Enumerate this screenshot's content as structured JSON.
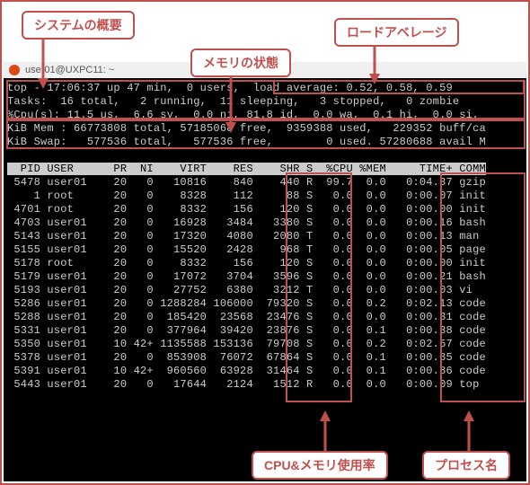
{
  "callouts": {
    "system_overview": "システムの概要",
    "memory_state": "メモリの状態",
    "load_average": "ロードアベレージ",
    "cpu_mem_usage": "CPU&メモリ使用率",
    "process_name": "プロセス名"
  },
  "window": {
    "title": "user01@UXPC11: ~"
  },
  "summary": {
    "line1": "top - 17:06:37 up 47 min,  0 users,  load average: 0.52, 0.58, 0.59",
    "line2": "Tasks:  16 total,   2 running,  11 sleeping,   3 stopped,   0 zombie",
    "line3": "%Cpu(s): 11.5 us,  6.6 sy,  0.0 ni, 81.8 id,  0.0 wa,  0.1 hi,  0.0 si,",
    "line4": "KiB Mem : 66773808 total, 57185068 free,  9359388 used,   229352 buff/ca",
    "line5": "KiB Swap:   577536 total,   577536 free,        0 used. 57280688 avail M"
  },
  "header": "  PID USER      PR  NI    VIRT    RES    SHR S  %CPU %MEM     TIME+ COMM",
  "rows": [
    " 5478 user01    20   0   10816    840    440 R  99.7  0.0   0:04.37 gzip",
    "    1 root      20   0    8328    112     88 S   0.0  0.0   0:00.07 init",
    " 4701 root      20   0    8332    156    120 S   0.0  0.0   0:00.00 init",
    " 4703 user01    20   0   16928   3484   3380 S   0.0  0.0   0:00.16 bash",
    " 5143 user01    20   0   17320   4080   2080 T   0.0  0.0   0:00.13 man",
    " 5155 user01    20   0   15520   2428    968 T   0.0  0.0   0:00.05 page",
    " 5178 root      20   0    8332    156    120 S   0.0  0.0   0:00.00 init",
    " 5179 user01    20   0   17072   3704   3596 S   0.0  0.0   0:00.21 bash",
    " 5193 user01    20   0   27752   6380   3212 T   0.0  0.0   0:00.03 vi  ",
    " 5286 user01    20   0 1288284 106000  79320 S   0.0  0.2   0:02.13 code",
    " 5288 user01    20   0  185420  23568  23476 S   0.0  0.0   0:00.31 code",
    " 5331 user01    20   0  377964  39420  23876 S   0.0  0.1   0:00.38 code",
    " 5350 user01    10 42+ 1135588 153136  79708 S   0.0  0.2   0:02.57 code",
    " 5378 user01    20   0  853908  76072  67864 S   0.0  0.1   0:00.85 code",
    " 5391 user01    10 42+  960560  63928  31464 S   0.0  0.1   0:00.86 code",
    " 5443 user01    20   0   17644   2124   1512 R   0.0  0.0   0:00.09 top "
  ]
}
